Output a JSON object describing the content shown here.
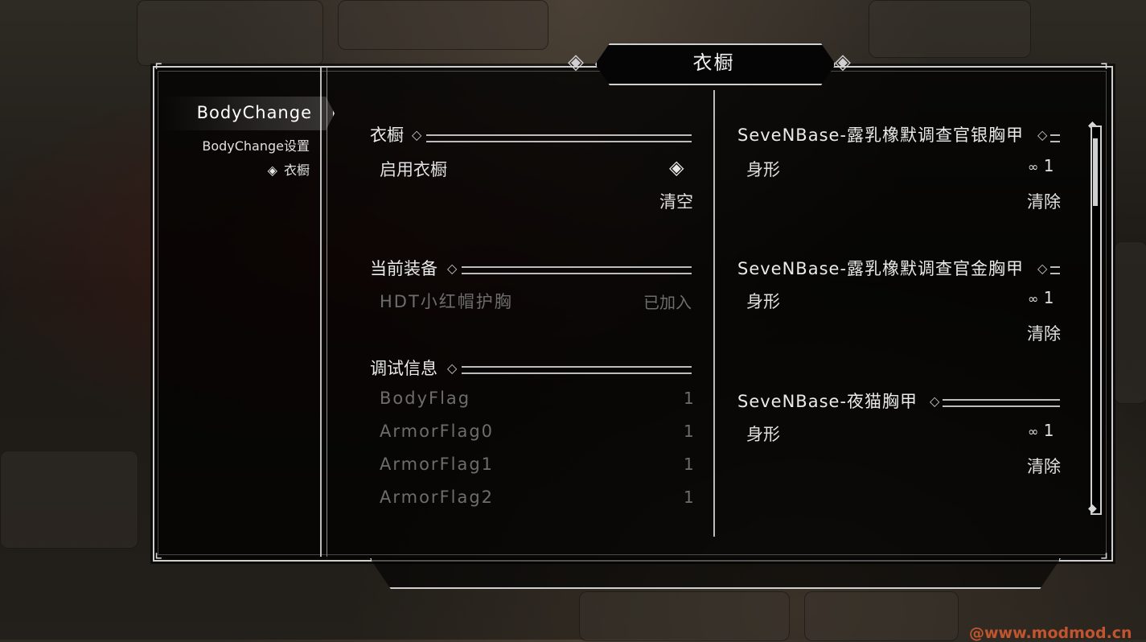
{
  "menu_title": "衣橱",
  "sidebar": {
    "selected": "BodyChange",
    "items": [
      "BodyChange设置",
      "衣橱"
    ]
  },
  "left_column": {
    "wardrobe": {
      "header": "衣橱",
      "enable_label": "启用衣橱",
      "clear_label": "清空"
    },
    "equipment": {
      "header": "当前装备",
      "item_name": "HDT小红帽护胸",
      "item_status": "已加入"
    },
    "debug": {
      "header": "调试信息",
      "rows": [
        {
          "label": "BodyFlag",
          "value": "1"
        },
        {
          "label": "ArmorFlag0",
          "value": "1"
        },
        {
          "label": "ArmorFlag1",
          "value": "1"
        },
        {
          "label": "ArmorFlag2",
          "value": "1"
        }
      ]
    }
  },
  "right_column": {
    "armors": [
      {
        "name": "SeveNBase-露乳橡默调查官银胸甲",
        "body_label": "身形",
        "body_value": "1",
        "remove_label": "清除"
      },
      {
        "name": "SeveNBase-露乳橡默调查官金胸甲",
        "body_label": "身形",
        "body_value": "1",
        "remove_label": "清除"
      },
      {
        "name": "SeveNBase-夜猫胸甲",
        "body_label": "身形",
        "body_value": "1",
        "remove_label": "清除"
      }
    ]
  },
  "watermark": "@www.modmod.cn",
  "colors": {
    "frame": "#cfcfcf",
    "text": "#e6e6e6",
    "disabled": "#6d6d6d",
    "watermark": "#c0552f"
  }
}
